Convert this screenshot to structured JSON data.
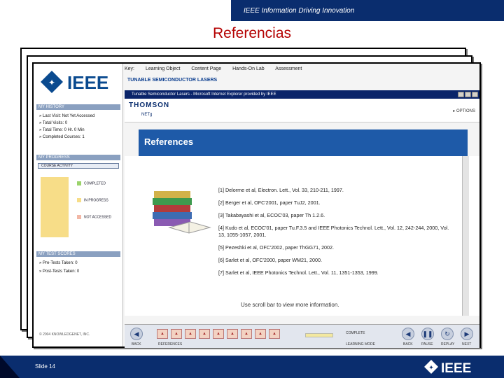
{
  "header": {
    "tagline": "IEEE Information Driving Innovation",
    "slide_title": "Referencias"
  },
  "left_panel": {
    "logo_text": "IEEE",
    "history_title": "MY HISTORY",
    "stats": [
      {
        "label": "Last Visit:",
        "value": "Not Yet Accessed"
      },
      {
        "label": "Total Visits:",
        "value": "0"
      },
      {
        "label": "Total Time:",
        "value": "0 Hr. 0 Min"
      },
      {
        "label": "Completed Courses:",
        "value": "1"
      }
    ],
    "progress_title": "MY PROGRESS",
    "select_value": "COURSE ACTIVITY",
    "legend": [
      "COMPLETED",
      "IN PROGRESS",
      "NOT ACCESSED"
    ],
    "legend_colors": [
      "#9bd36b",
      "#f7dd88",
      "#f2b7a6"
    ],
    "tests_title": "MY TEST SCORES",
    "tests": [
      "Pre-Tests Taken: 0",
      "Post-Tests Taken: 0"
    ],
    "copyright": "© 2004 KNOWLEDGENET, INC."
  },
  "key_bar": {
    "label": "Key:",
    "items": [
      "Learning Object",
      "Content Page",
      "Hands-On Lab",
      "Assessment"
    ]
  },
  "topic": "TUNABLE SEMICONDUCTOR LASERS",
  "browser": {
    "title": "Tunable Semiconductor Lasers - Microsoft Internet Explorer provided by IEEE",
    "brand": "THOMSON",
    "sub_brand": "NETg",
    "options": "OPTIONS"
  },
  "content": {
    "heading": "References",
    "references": [
      "[1] Delorme et al, Electron. Lett., Vol. 33, 210-211, 1997.",
      "[2] Berger et al, OFC'2001, paper TuJ2, 2001.",
      "[3] Takabayashi et al, ECOC'03, paper Th 1.2.6.",
      "[4] Kudo et al, ECOC'01, paper Tu.F.3.5 and IEEE Photonics Technol. Lett., Vol. 12, 242-244, 2000, Vol. 13, 1055-1057, 2001.",
      "[5] Pezeshki et al, OFC'2002, paper ThGG71, 2002.",
      "[6] Sarlet et al, OFC'2000, paper WM21, 2000.",
      "[7] Sarlet et al, IEEE Photonics Technol. Lett., Vol. 11, 1351-1353, 1999."
    ],
    "scroll_note": "Use scroll bar to view more information."
  },
  "nav": {
    "labels": [
      "BACK",
      "REFERENCES",
      "BACK",
      "PAUSE",
      "REPLAY",
      "NEXT"
    ],
    "complete_label": "COMPLETE",
    "learning_mode": "LEARNING MODE"
  },
  "footer": {
    "slide_number": "Slide 14",
    "logo_text": "IEEE"
  }
}
